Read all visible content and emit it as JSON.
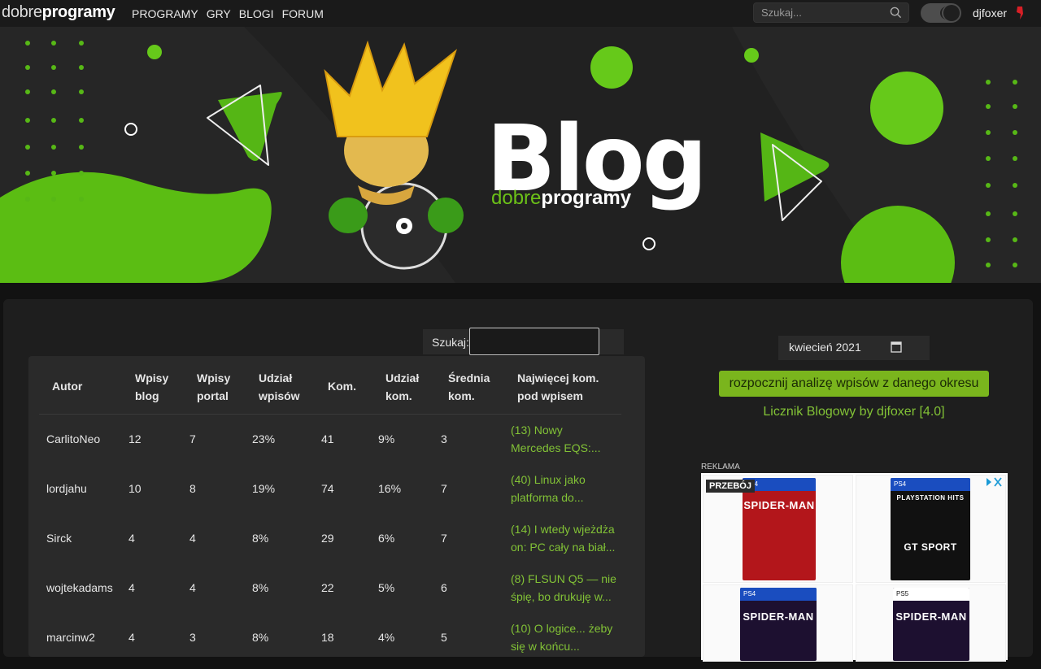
{
  "nav": {
    "logo_light": "dobre",
    "logo_bold": "programy",
    "items": [
      "PROGRAMY",
      "GRY",
      "BLOGI",
      "FORUM"
    ],
    "search_placeholder": "Szukaj...",
    "username": "djfoxer"
  },
  "banner": {
    "title": "Blog",
    "sub_light": "dobre",
    "sub_bold": "programy"
  },
  "table_search": {
    "label": "Szukaj:",
    "value": ""
  },
  "table": {
    "headers": [
      {
        "l1": "Autor",
        "l2": ""
      },
      {
        "l1": "Wpisy",
        "l2": "blog"
      },
      {
        "l1": "Wpisy",
        "l2": "portal"
      },
      {
        "l1": "Udział",
        "l2": "wpisów"
      },
      {
        "l1": "Kom.",
        "l2": ""
      },
      {
        "l1": "Udział",
        "l2": "kom."
      },
      {
        "l1": "Średnia",
        "l2": "kom."
      },
      {
        "l1": "Najwięcej kom.",
        "l2": "pod wpisem"
      }
    ],
    "rows": [
      {
        "author": "CarlitoNeo",
        "blog": "12",
        "portal": "7",
        "share": "23%",
        "kom": "41",
        "kom_share": "9%",
        "avg": "3",
        "top1": "(13) Nowy",
        "top2": "Mercedes EQS:..."
      },
      {
        "author": "lordjahu",
        "blog": "10",
        "portal": "8",
        "share": "19%",
        "kom": "74",
        "kom_share": "16%",
        "avg": "7",
        "top1": "(40) Linux jako",
        "top2": "platforma do..."
      },
      {
        "author": "Sirck",
        "blog": "4",
        "portal": "4",
        "share": "8%",
        "kom": "29",
        "kom_share": "6%",
        "avg": "7",
        "top1": "(14) I wtedy wjeżdża",
        "top2": "on: PC cały na biał..."
      },
      {
        "author": "wojtekadams",
        "blog": "4",
        "portal": "4",
        "share": "8%",
        "kom": "22",
        "kom_share": "5%",
        "avg": "6",
        "top1": "(8) FLSUN Q5 — nie",
        "top2": "śpię, bo drukuję w..."
      },
      {
        "author": "marcinw2",
        "blog": "4",
        "portal": "3",
        "share": "8%",
        "kom": "18",
        "kom_share": "4%",
        "avg": "5",
        "top1": "(10) O logice... żeby",
        "top2": "się w końcu..."
      }
    ]
  },
  "sidebar": {
    "month": "kwiecień 2021",
    "analyze_button": "rozpocznij analizę wpisów z danego okresu",
    "credits": "Licznik Blogowy by djfoxer [4.0]"
  },
  "ad": {
    "label": "REKLAMA",
    "tag": "PRZEBÓJ",
    "products": [
      {
        "platform": "PS4",
        "title": "SPIDER-MAN",
        "sub": ""
      },
      {
        "platform": "PS4",
        "title": "GT SPORT",
        "sub": "PLAYSTATION HITS"
      },
      {
        "platform": "PS4",
        "title": "SPIDER-MAN",
        "sub": ""
      },
      {
        "platform": "PS5",
        "title": "SPIDER-MAN",
        "sub": ""
      }
    ]
  },
  "colors": {
    "accent": "#82c236",
    "button": "#7ab51d",
    "panel": "#1e1e1e",
    "table_bg": "#2a2a2a"
  }
}
